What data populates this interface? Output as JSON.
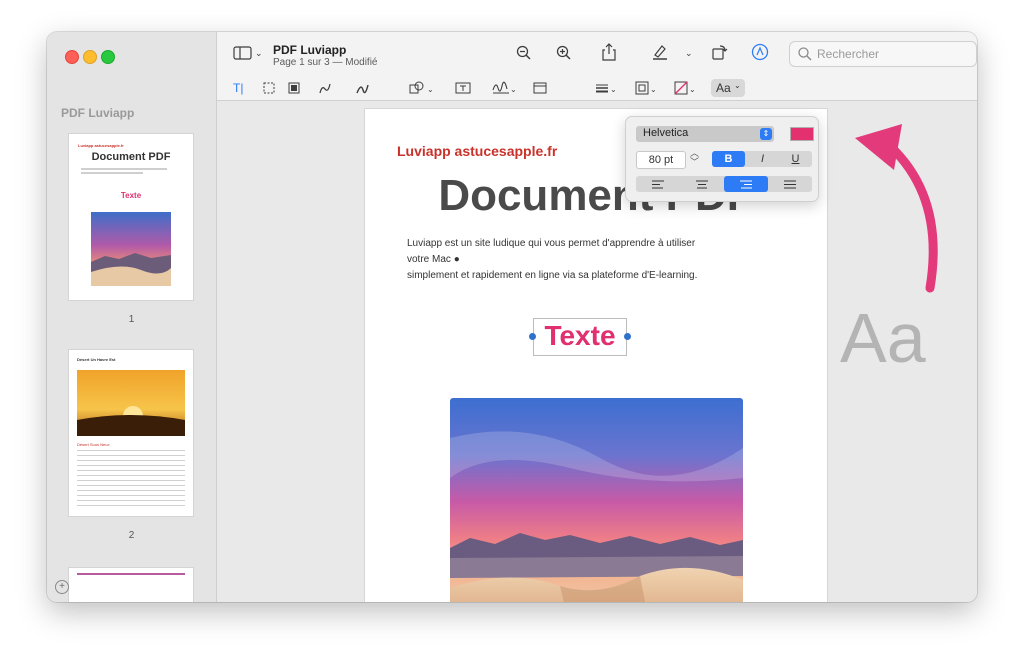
{
  "window": {
    "title": "PDF Luviapp",
    "subtitle": "Page 1 sur 3 — Modifié"
  },
  "search": {
    "placeholder": "Rechercher"
  },
  "sidebar": {
    "title": "PDF Luviapp",
    "thumbnails": [
      {
        "page": "1",
        "brand": "Luviapp astucesapple.fr",
        "title": "Document PDF",
        "text": "Texte"
      },
      {
        "page": "2",
        "title": "Désert Un Havre Est",
        "subtitle": "Désert Sous Neux"
      }
    ]
  },
  "document": {
    "brand": "Luviapp astucesapple.fr",
    "title": "Document PDF",
    "paragraph_line1": "Luviapp est un site ludique qui vous permet d'apprendre à utiliser votre Mac ",
    "paragraph_line2": "simplement et rapidement en ligne via sa plateforme d'E-learning.",
    "textbox": "Texte"
  },
  "format_popover": {
    "font": "Helvetica",
    "color": "#e3306f",
    "size": "80 pt",
    "bold": "B",
    "italic": "I",
    "underline": "U",
    "selected_style": "B",
    "selected_alignment": "right"
  },
  "toolbar": {
    "text_style_button": "Aa"
  },
  "overlay": {
    "aa_label": "Aa"
  },
  "colors": {
    "accent": "#2d7cf6",
    "text_pink": "#e0306f",
    "brand_red": "#c9322a",
    "arrow": "#e33a7c"
  }
}
